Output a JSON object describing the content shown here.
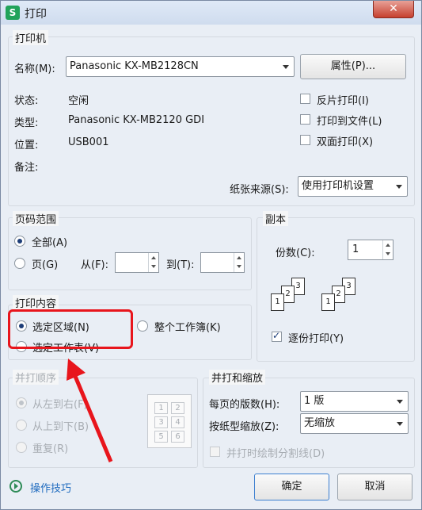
{
  "window": {
    "title": "打印",
    "app_icon_letter": "S",
    "close_glyph": "✕"
  },
  "printer": {
    "group_label": "打印机",
    "name_label": "名称(M):",
    "name_value": "Panasonic KX-MB2128CN",
    "properties_button": "属性(P)...",
    "status_label": "状态:",
    "status_value": "空闲",
    "type_label": "类型:",
    "type_value": "Panasonic KX-MB2120 GDI",
    "location_label": "位置:",
    "location_value": "USB001",
    "comment_label": "备注:",
    "reverse_print": "反片打印(I)",
    "print_to_file": "打印到文件(L)",
    "duplex": "双面打印(X)",
    "paper_source_label": "纸张来源(S):",
    "paper_source_value": "使用打印机设置"
  },
  "page_range": {
    "group_label": "页码范围",
    "all": "全部(A)",
    "pages": "页(G)",
    "from_label": "从(F):",
    "to_label": "到(T):"
  },
  "copies": {
    "group_label": "副本",
    "count_label": "份数(C):",
    "count_value": "1",
    "collate": "逐份打印(Y)"
  },
  "print_content": {
    "group_label": "打印内容",
    "selection": "选定区域(N)",
    "whole_workbook": "整个工作簿(K)",
    "active_sheet": "选定工作表(V)"
  },
  "collate_order": {
    "group_label": "并打顺序",
    "left_to_right": "从左到右(F)",
    "top_to_bottom": "从上到下(B)",
    "repeat": "重复(R)",
    "grid_numbers": [
      "1",
      "2",
      "3",
      "4",
      "5",
      "6"
    ]
  },
  "zoom": {
    "group_label": "并打和缩放",
    "pages_per_sheet_label": "每页的版数(H):",
    "pages_per_sheet_value": "1 版",
    "scale_label": "按纸型缩放(Z):",
    "scale_value": "无缩放",
    "draw_separators": "并打时绘制分割线(D)"
  },
  "footer": {
    "tips_link": "操作技巧",
    "ok_button": "确定",
    "cancel_button": "取消"
  }
}
